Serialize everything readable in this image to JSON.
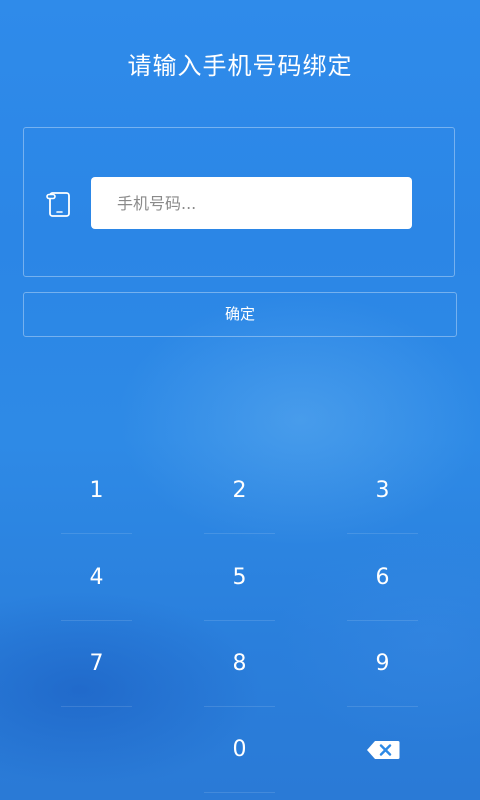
{
  "header": {
    "title": "请输入手机号码绑定"
  },
  "form": {
    "phone_icon": "phone-icon",
    "phone_input": {
      "value": "",
      "placeholder": "手机号码..."
    },
    "confirm_label": "确定"
  },
  "keypad": {
    "keys": [
      "1",
      "2",
      "3",
      "4",
      "5",
      "6",
      "7",
      "8",
      "9",
      "",
      "0"
    ],
    "delete_icon": "backspace-icon"
  },
  "colors": {
    "background": "#2e8ae6",
    "text": "#ffffff",
    "input_background": "#ffffff",
    "placeholder": "#8a8a8a"
  }
}
